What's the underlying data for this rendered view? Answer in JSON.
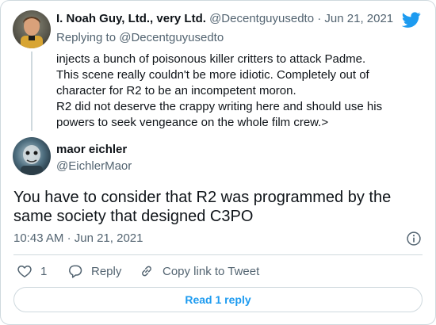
{
  "parent": {
    "name": "I. Noah Guy, Ltd., very Ltd.",
    "handle": "@Decentguyusedto",
    "date": "Jun 21, 2021",
    "replying_label": "Replying to",
    "replying_to": "@Decentguyusedto",
    "lines": [
      "injects a bunch of poisonous killer critters to attack Padme.",
      "This scene really couldn't be more idiotic. Completely out of character for R2 to be an incompetent moron.",
      "R2 did not deserve the crappy writing here and should use his powers to seek vengeance on the whole film crew.>"
    ]
  },
  "tweet": {
    "name": "maor eichler",
    "handle": "@EichlerMaor",
    "text": "You have to consider that R2 was programmed by the same society that designed C3PO",
    "time": "10:43 AM",
    "date": "Jun 21, 2021",
    "likes": "1"
  },
  "actions": {
    "reply_label": "Reply",
    "copy_label": "Copy link to Tweet"
  },
  "read_reply_label": "Read 1 reply",
  "colors": {
    "accent": "#1d9bf0",
    "secondary_text": "#536471",
    "border": "#cfd9de"
  },
  "icons": [
    "twitter-bird-icon",
    "info-icon",
    "heart-icon",
    "reply-bubble-icon",
    "link-icon"
  ]
}
